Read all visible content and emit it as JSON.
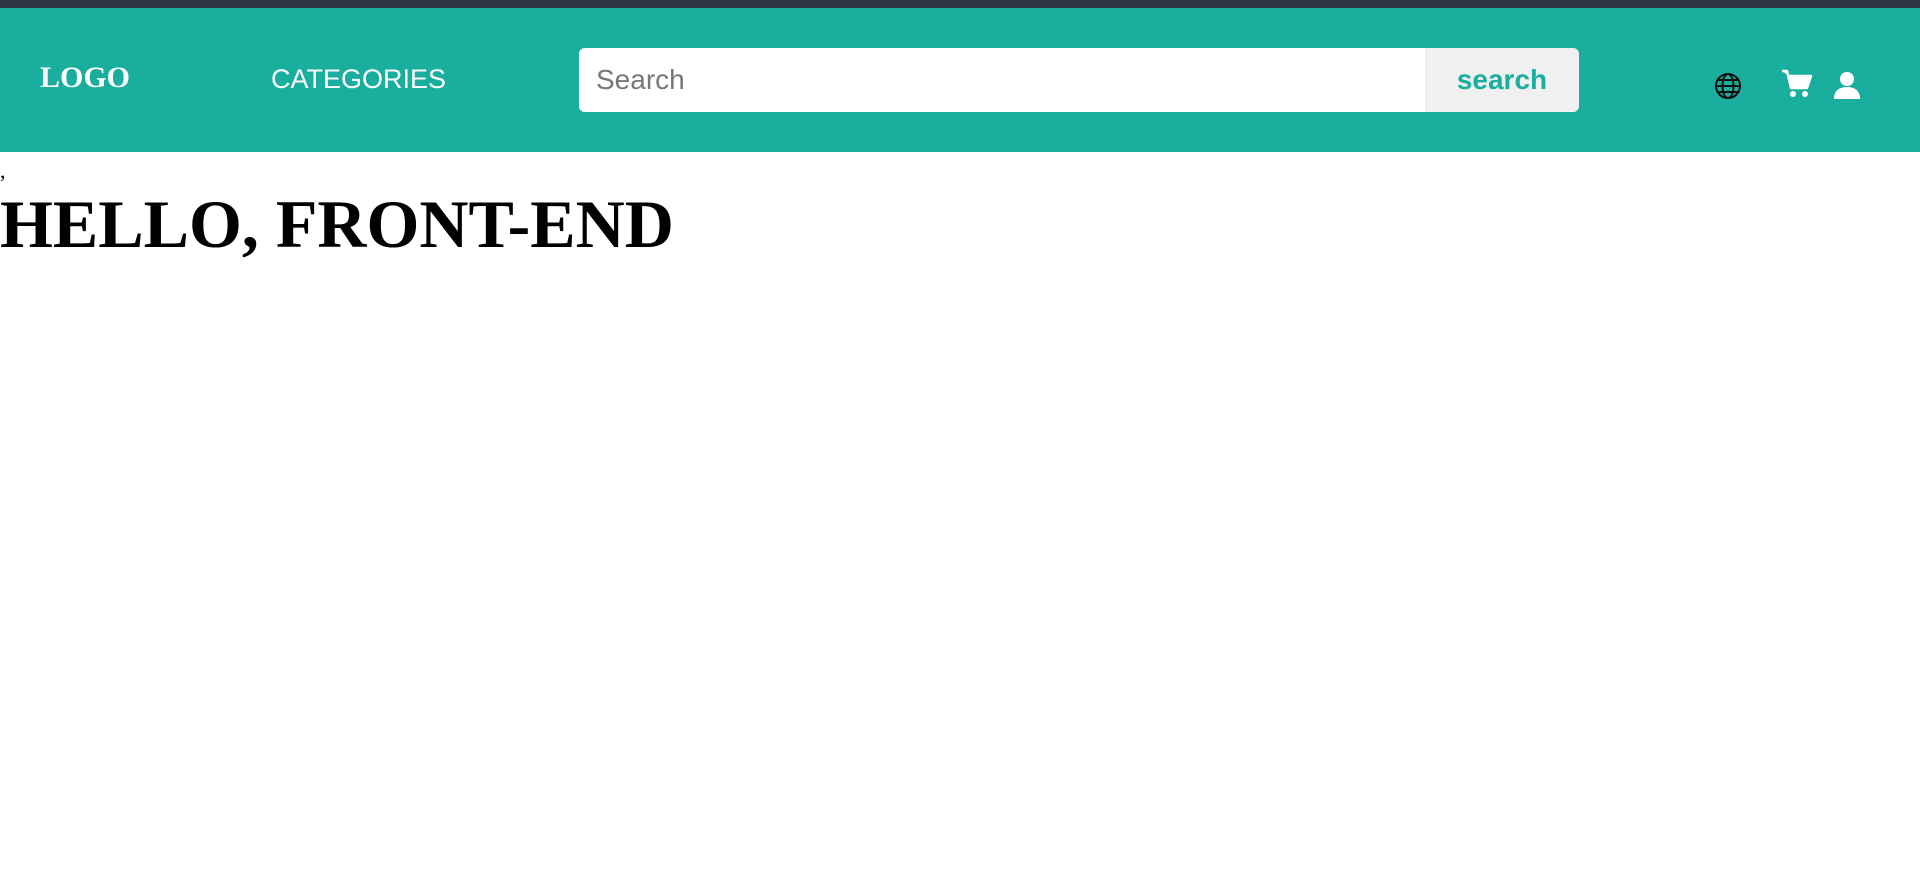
{
  "colors": {
    "topbar": "#2f3540",
    "navbar": "#1aae9f",
    "search_button_bg": "#f0f0f0",
    "search_button_text": "#1aae9f"
  },
  "header": {
    "logo": "LOGO",
    "categories_label": "CATEGORIES",
    "search": {
      "placeholder": "Search",
      "value": "",
      "button_label": "search"
    },
    "icons": [
      "globe-icon",
      "cart-icon",
      "user-icon"
    ]
  },
  "main": {
    "comma_text": ",",
    "title": "HELLO, FRONT-END"
  }
}
